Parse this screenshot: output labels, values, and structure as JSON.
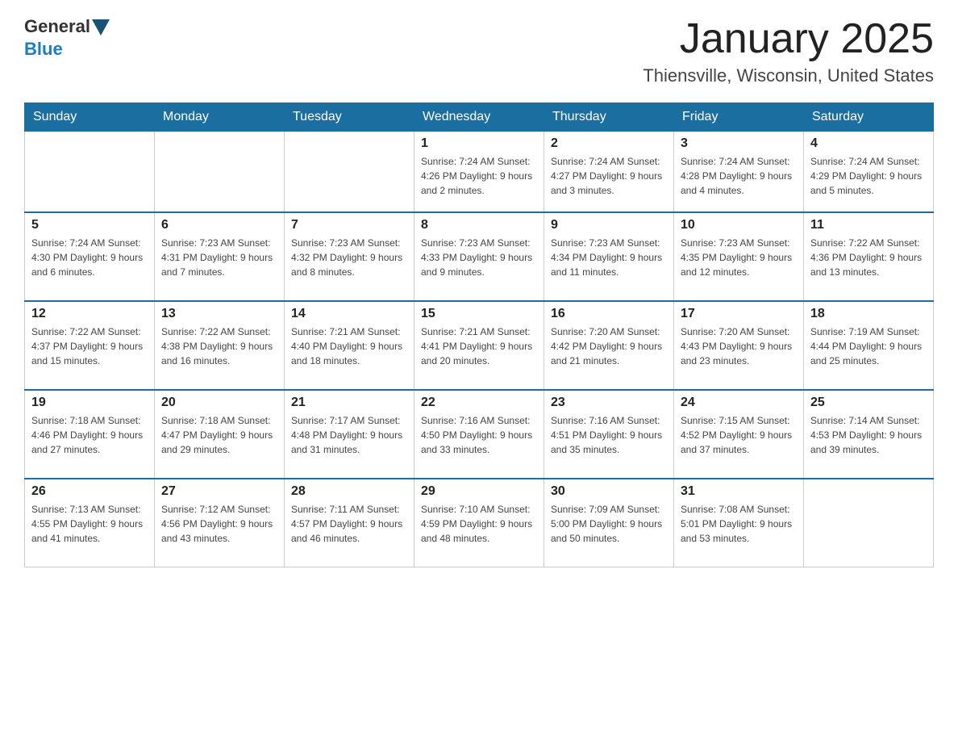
{
  "header": {
    "logo_general": "General",
    "logo_blue": "Blue",
    "title": "January 2025",
    "subtitle": "Thiensville, Wisconsin, United States"
  },
  "days_of_week": [
    "Sunday",
    "Monday",
    "Tuesday",
    "Wednesday",
    "Thursday",
    "Friday",
    "Saturday"
  ],
  "weeks": [
    [
      {
        "day": "",
        "info": ""
      },
      {
        "day": "",
        "info": ""
      },
      {
        "day": "",
        "info": ""
      },
      {
        "day": "1",
        "info": "Sunrise: 7:24 AM\nSunset: 4:26 PM\nDaylight: 9 hours\nand 2 minutes."
      },
      {
        "day": "2",
        "info": "Sunrise: 7:24 AM\nSunset: 4:27 PM\nDaylight: 9 hours\nand 3 minutes."
      },
      {
        "day": "3",
        "info": "Sunrise: 7:24 AM\nSunset: 4:28 PM\nDaylight: 9 hours\nand 4 minutes."
      },
      {
        "day": "4",
        "info": "Sunrise: 7:24 AM\nSunset: 4:29 PM\nDaylight: 9 hours\nand 5 minutes."
      }
    ],
    [
      {
        "day": "5",
        "info": "Sunrise: 7:24 AM\nSunset: 4:30 PM\nDaylight: 9 hours\nand 6 minutes."
      },
      {
        "day": "6",
        "info": "Sunrise: 7:23 AM\nSunset: 4:31 PM\nDaylight: 9 hours\nand 7 minutes."
      },
      {
        "day": "7",
        "info": "Sunrise: 7:23 AM\nSunset: 4:32 PM\nDaylight: 9 hours\nand 8 minutes."
      },
      {
        "day": "8",
        "info": "Sunrise: 7:23 AM\nSunset: 4:33 PM\nDaylight: 9 hours\nand 9 minutes."
      },
      {
        "day": "9",
        "info": "Sunrise: 7:23 AM\nSunset: 4:34 PM\nDaylight: 9 hours\nand 11 minutes."
      },
      {
        "day": "10",
        "info": "Sunrise: 7:23 AM\nSunset: 4:35 PM\nDaylight: 9 hours\nand 12 minutes."
      },
      {
        "day": "11",
        "info": "Sunrise: 7:22 AM\nSunset: 4:36 PM\nDaylight: 9 hours\nand 13 minutes."
      }
    ],
    [
      {
        "day": "12",
        "info": "Sunrise: 7:22 AM\nSunset: 4:37 PM\nDaylight: 9 hours\nand 15 minutes."
      },
      {
        "day": "13",
        "info": "Sunrise: 7:22 AM\nSunset: 4:38 PM\nDaylight: 9 hours\nand 16 minutes."
      },
      {
        "day": "14",
        "info": "Sunrise: 7:21 AM\nSunset: 4:40 PM\nDaylight: 9 hours\nand 18 minutes."
      },
      {
        "day": "15",
        "info": "Sunrise: 7:21 AM\nSunset: 4:41 PM\nDaylight: 9 hours\nand 20 minutes."
      },
      {
        "day": "16",
        "info": "Sunrise: 7:20 AM\nSunset: 4:42 PM\nDaylight: 9 hours\nand 21 minutes."
      },
      {
        "day": "17",
        "info": "Sunrise: 7:20 AM\nSunset: 4:43 PM\nDaylight: 9 hours\nand 23 minutes."
      },
      {
        "day": "18",
        "info": "Sunrise: 7:19 AM\nSunset: 4:44 PM\nDaylight: 9 hours\nand 25 minutes."
      }
    ],
    [
      {
        "day": "19",
        "info": "Sunrise: 7:18 AM\nSunset: 4:46 PM\nDaylight: 9 hours\nand 27 minutes."
      },
      {
        "day": "20",
        "info": "Sunrise: 7:18 AM\nSunset: 4:47 PM\nDaylight: 9 hours\nand 29 minutes."
      },
      {
        "day": "21",
        "info": "Sunrise: 7:17 AM\nSunset: 4:48 PM\nDaylight: 9 hours\nand 31 minutes."
      },
      {
        "day": "22",
        "info": "Sunrise: 7:16 AM\nSunset: 4:50 PM\nDaylight: 9 hours\nand 33 minutes."
      },
      {
        "day": "23",
        "info": "Sunrise: 7:16 AM\nSunset: 4:51 PM\nDaylight: 9 hours\nand 35 minutes."
      },
      {
        "day": "24",
        "info": "Sunrise: 7:15 AM\nSunset: 4:52 PM\nDaylight: 9 hours\nand 37 minutes."
      },
      {
        "day": "25",
        "info": "Sunrise: 7:14 AM\nSunset: 4:53 PM\nDaylight: 9 hours\nand 39 minutes."
      }
    ],
    [
      {
        "day": "26",
        "info": "Sunrise: 7:13 AM\nSunset: 4:55 PM\nDaylight: 9 hours\nand 41 minutes."
      },
      {
        "day": "27",
        "info": "Sunrise: 7:12 AM\nSunset: 4:56 PM\nDaylight: 9 hours\nand 43 minutes."
      },
      {
        "day": "28",
        "info": "Sunrise: 7:11 AM\nSunset: 4:57 PM\nDaylight: 9 hours\nand 46 minutes."
      },
      {
        "day": "29",
        "info": "Sunrise: 7:10 AM\nSunset: 4:59 PM\nDaylight: 9 hours\nand 48 minutes."
      },
      {
        "day": "30",
        "info": "Sunrise: 7:09 AM\nSunset: 5:00 PM\nDaylight: 9 hours\nand 50 minutes."
      },
      {
        "day": "31",
        "info": "Sunrise: 7:08 AM\nSunset: 5:01 PM\nDaylight: 9 hours\nand 53 minutes."
      },
      {
        "day": "",
        "info": ""
      }
    ]
  ]
}
